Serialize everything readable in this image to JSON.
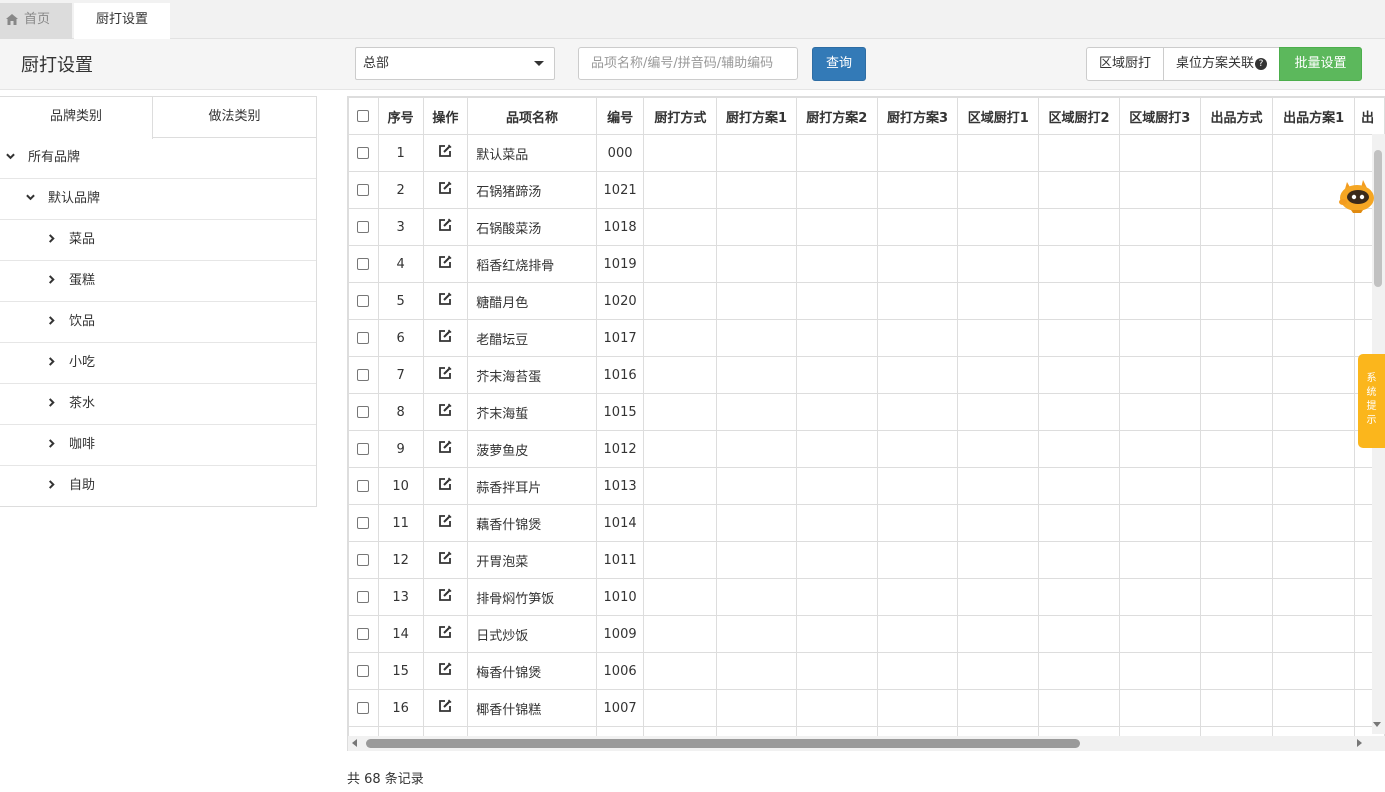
{
  "tabs": {
    "home": "首页",
    "active": "厨打设置"
  },
  "header": {
    "title": "厨打设置",
    "select_value": "总部",
    "search_placeholder": "品项名称/编号/拼音码/辅助编码",
    "query_label": "查询",
    "btn_area": "区域厨打",
    "btn_table_plan": "桌位方案关联",
    "btn_batch": "批量设置"
  },
  "left": {
    "tab_brand": "品牌类别",
    "tab_method": "做法类别",
    "tree": [
      {
        "label": "所有品牌",
        "level": 0,
        "expanded": true
      },
      {
        "label": "默认品牌",
        "level": 1,
        "expanded": true
      },
      {
        "label": "菜品",
        "level": 2,
        "expanded": false
      },
      {
        "label": "蛋糕",
        "level": 2,
        "expanded": false
      },
      {
        "label": "饮品",
        "level": 2,
        "expanded": false
      },
      {
        "label": "小吃",
        "level": 2,
        "expanded": false
      },
      {
        "label": "茶水",
        "level": 2,
        "expanded": false
      },
      {
        "label": "咖啡",
        "level": 2,
        "expanded": false
      },
      {
        "label": "自助",
        "level": 2,
        "expanded": false
      }
    ]
  },
  "table": {
    "headers": [
      "序号",
      "操作",
      "品项名称",
      "编号",
      "厨打方式",
      "厨打方案1",
      "厨打方案2",
      "厨打方案3",
      "区域厨打1",
      "区域厨打2",
      "区域厨打3",
      "出品方式",
      "出品方案1",
      "出"
    ],
    "rows": [
      {
        "no": "1",
        "name": "默认菜品",
        "code": "000"
      },
      {
        "no": "2",
        "name": "石锅猪蹄汤",
        "code": "1021"
      },
      {
        "no": "3",
        "name": "石锅酸菜汤",
        "code": "1018"
      },
      {
        "no": "4",
        "name": "稻香红烧排骨",
        "code": "1019"
      },
      {
        "no": "5",
        "name": "糖醋月色",
        "code": "1020"
      },
      {
        "no": "6",
        "name": "老醋坛豆",
        "code": "1017"
      },
      {
        "no": "7",
        "name": "芥末海苔蛋",
        "code": "1016"
      },
      {
        "no": "8",
        "name": "芥末海蜇",
        "code": "1015"
      },
      {
        "no": "9",
        "name": "菠萝鱼皮",
        "code": "1012"
      },
      {
        "no": "10",
        "name": "蒜香拌耳片",
        "code": "1013"
      },
      {
        "no": "11",
        "name": "藕香什锦煲",
        "code": "1014"
      },
      {
        "no": "12",
        "name": "开胃泡菜",
        "code": "1011"
      },
      {
        "no": "13",
        "name": "排骨焖竹笋饭",
        "code": "1010"
      },
      {
        "no": "14",
        "name": "日式炒饭",
        "code": "1009"
      },
      {
        "no": "15",
        "name": "梅香什锦煲",
        "code": "1006"
      },
      {
        "no": "16",
        "name": "椰香什锦糕",
        "code": "1007"
      },
      {
        "no": "",
        "name": "",
        "code": ""
      }
    ]
  },
  "footer": "共 68 条记录",
  "sys_tip": [
    "系",
    "统",
    "提",
    "示"
  ]
}
